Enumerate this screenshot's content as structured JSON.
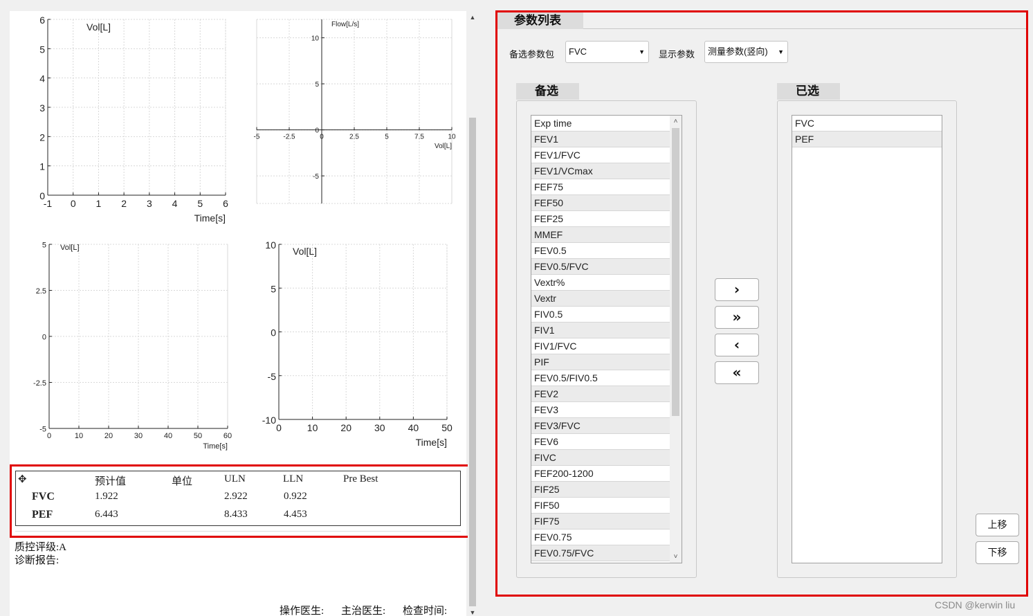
{
  "charts": {
    "vol_time_1": {
      "y_label": "Vol[L]",
      "x_label": "Time[s]",
      "x_ticks": [
        "-1",
        "0",
        "1",
        "2",
        "3",
        "4",
        "5",
        "6"
      ],
      "y_ticks": [
        "0",
        "1",
        "2",
        "3",
        "4",
        "5",
        "6"
      ]
    },
    "flow_volume": {
      "y_label": "Flow[L/s]",
      "x_label": "Vol[L]",
      "x_ticks": [
        "-5",
        "-2.5",
        "0",
        "2.5",
        "5",
        "7.5",
        "10"
      ],
      "y_ticks": [
        "10",
        "5",
        "0",
        "-5"
      ]
    },
    "vol_time_2": {
      "y_label": "Vol[L]",
      "x_label": "Time[s]",
      "x_ticks": [
        "0",
        "10",
        "20",
        "30",
        "40",
        "50",
        "60"
      ],
      "y_ticks": [
        "5",
        "2.5",
        "0",
        "-2.5",
        "-5"
      ]
    },
    "vol_time_3": {
      "y_label": "Vol[L]",
      "x_label": "Time[s]",
      "x_ticks": [
        "0",
        "10",
        "20",
        "30",
        "40",
        "50"
      ],
      "y_ticks": [
        "10",
        "5",
        "0",
        "-5",
        "-10"
      ]
    }
  },
  "chart_data": [
    {
      "type": "line",
      "title": "",
      "xlabel": "Time[s]",
      "ylabel": "Vol[L]",
      "xlim": [
        -1,
        6
      ],
      "ylim": [
        0,
        6
      ],
      "grid": true,
      "series": []
    },
    {
      "type": "line",
      "title": "",
      "xlabel": "Vol[L]",
      "ylabel": "Flow[L/s]",
      "xlim": [
        -5,
        10
      ],
      "ylim": [
        -8,
        12
      ],
      "grid": true,
      "series": []
    },
    {
      "type": "line",
      "title": "",
      "xlabel": "Time[s]",
      "ylabel": "Vol[L]",
      "xlim": [
        0,
        60
      ],
      "ylim": [
        -5,
        5
      ],
      "grid": true,
      "series": []
    },
    {
      "type": "line",
      "title": "",
      "xlabel": "Time[s]",
      "ylabel": "Vol[L]",
      "xlim": [
        0,
        50
      ],
      "ylim": [
        -10,
        10
      ],
      "grid": true,
      "series": []
    }
  ],
  "results_table": {
    "headers": [
      "预计值",
      "单位",
      "ULN",
      "LLN",
      "Pre Best"
    ],
    "rows": [
      {
        "name": "FVC",
        "predicted": "1.922",
        "unit": "",
        "uln": "2.922",
        "lln": "0.922",
        "pre_best": ""
      },
      {
        "name": "PEF",
        "predicted": "6.443",
        "unit": "",
        "uln": "8.433",
        "lln": "4.453",
        "pre_best": ""
      }
    ]
  },
  "report": {
    "quality_grade": "质控评级:A",
    "diagnosis": "诊断报告:",
    "operator": "操作医生:",
    "attending": "主治医生:",
    "exam_time": "检查时间:"
  },
  "param_panel": {
    "title": "参数列表",
    "package_label": "备选参数包",
    "package_value": "FVC",
    "display_label": "显示参数",
    "display_value": "测量参数(竖向)",
    "available_title": "备选",
    "selected_title": "已选",
    "available": [
      "Exp time",
      "FEV1",
      "FEV1/FVC",
      "FEV1/VCmax",
      "FEF75",
      "FEF50",
      "FEF25",
      "MMEF",
      "FEV0.5",
      "FEV0.5/FVC",
      "Vextr%",
      "Vextr",
      "FIV0.5",
      "FIV1",
      "FIV1/FVC",
      "PIF",
      "FEV0.5/FIV0.5",
      "FEV2",
      "FEV3",
      "FEV3/FVC",
      "FEV6",
      "FIVC",
      "FEF200-1200",
      "FIF25",
      "FIF50",
      "FIF75",
      "FEV0.75",
      "FEV0.75/FVC"
    ],
    "selected": [
      "FVC",
      "PEF"
    ],
    "btn_add": "›",
    "btn_add_all": "»",
    "btn_remove": "‹",
    "btn_remove_all": "«",
    "btn_up": "上移",
    "btn_down": "下移"
  },
  "watermark": "CSDN @kerwin liu"
}
